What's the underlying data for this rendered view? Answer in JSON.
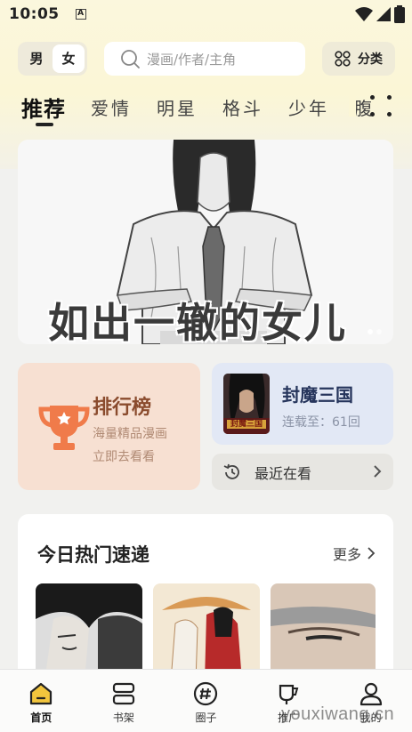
{
  "status_bar": {
    "time": "10:05",
    "notification_glyph": "A"
  },
  "header": {
    "gender_male": "男",
    "gender_female": "女",
    "search_placeholder": "漫画/作者/主角",
    "category_label": "分类"
  },
  "tabs": [
    "推荐",
    "爱情",
    "明星",
    "格斗",
    "少年",
    "腹"
  ],
  "banner": {
    "title": "如出一辙的女儿"
  },
  "ranking": {
    "title": "排行榜",
    "line1": "海量精品漫画",
    "line2": "立即去看看"
  },
  "latest": {
    "title": "封魔三国",
    "subtitle": "连载至：61回",
    "cover_text": "封魔三国"
  },
  "recent": {
    "label": "最近在看"
  },
  "hot": {
    "title": "今日热门速递",
    "more": "更多"
  },
  "bottom_nav": [
    {
      "label": "首页",
      "icon": "home-icon"
    },
    {
      "label": "书架",
      "icon": "bookshelf-icon"
    },
    {
      "label": "圈子",
      "icon": "hashtag-icon"
    },
    {
      "label": "推广",
      "icon": "promote-icon"
    },
    {
      "label": "我的",
      "icon": "profile-icon"
    }
  ],
  "watermark": "youxiwang.cn",
  "colors": {
    "accent_orange": "#f07b4a",
    "rank_bg": "#f7e0d2",
    "latest_bg": "#e2e8f5",
    "header_bg": "#fbf6d6",
    "nav_active": "#f2c53d"
  }
}
